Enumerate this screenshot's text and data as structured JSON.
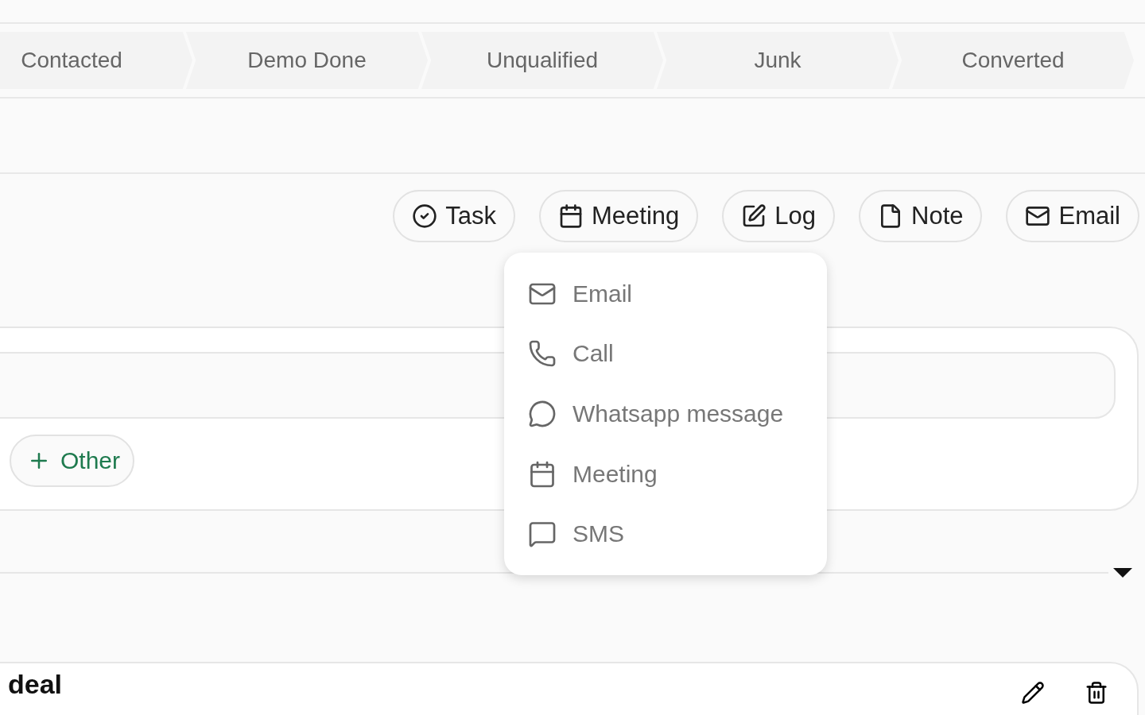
{
  "stages": [
    {
      "label": "Contacted",
      "selected": false
    },
    {
      "label": "Demo Done",
      "selected": false
    },
    {
      "label": "Unqualified",
      "selected": false
    },
    {
      "label": "Junk",
      "selected": false
    },
    {
      "label": "Converted",
      "selected": false
    }
  ],
  "actions": [
    {
      "label": "Task",
      "kind": "task"
    },
    {
      "label": "Meeting",
      "kind": "meeting"
    },
    {
      "label": "Log",
      "kind": "log"
    },
    {
      "label": "Note",
      "kind": "note"
    },
    {
      "label": "Email",
      "kind": "email"
    }
  ],
  "menu": {
    "items": [
      {
        "label": "Email",
        "kind": "email"
      },
      {
        "label": "Call",
        "kind": "call"
      },
      {
        "label": "Whatsapp message",
        "kind": "whatsapp"
      },
      {
        "label": "Meeting",
        "kind": "meeting"
      },
      {
        "label": "SMS",
        "kind": "sms"
      }
    ]
  },
  "other_button": "Other",
  "bottom_card": {
    "title": "deal"
  }
}
